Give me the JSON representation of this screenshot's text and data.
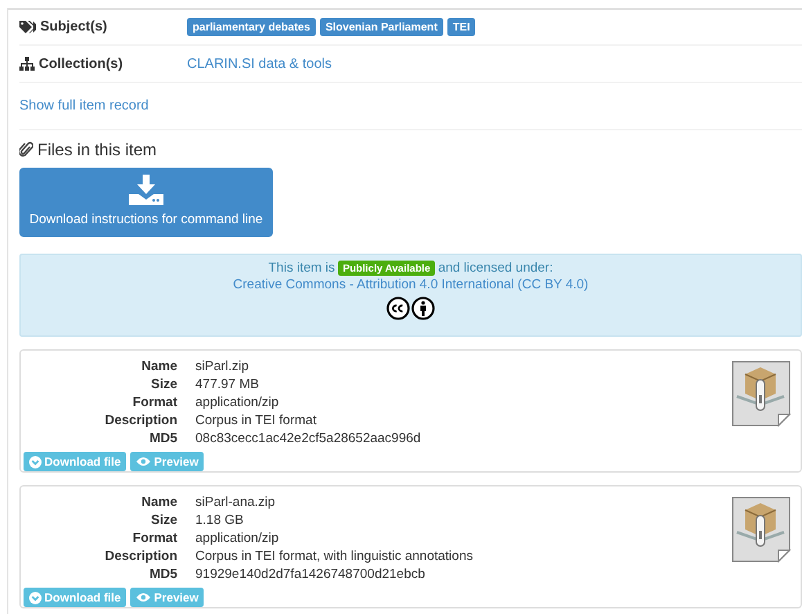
{
  "subjects": {
    "label": "Subject(s)",
    "tags": [
      "parliamentary debates",
      "Slovenian Parliament",
      "TEI"
    ]
  },
  "collections": {
    "label": "Collection(s)",
    "link": "CLARIN.SI data & tools"
  },
  "show_full_record": "Show full item record",
  "files_heading": "Files in this item",
  "download_instructions": "Download instructions for command line",
  "license": {
    "prefix": "This item is",
    "badge": "Publicly Available",
    "suffix": "and licensed under:",
    "link": "Creative Commons - Attribution 4.0 International (CC BY 4.0)"
  },
  "files": [
    {
      "fields": [
        {
          "label": "Name",
          "value": "siParl.zip"
        },
        {
          "label": "Size",
          "value": "477.97 MB"
        },
        {
          "label": "Format",
          "value": "application/zip"
        },
        {
          "label": "Description",
          "value": "Corpus in TEI format"
        },
        {
          "label": "MD5",
          "value": "08c83cecc1ac42e2cf5a28652aac996d"
        }
      ],
      "buttons": [
        {
          "kind": "download",
          "label": "Download file"
        },
        {
          "kind": "preview",
          "label": "Preview"
        }
      ]
    },
    {
      "fields": [
        {
          "label": "Name",
          "value": "siParl-ana.zip"
        },
        {
          "label": "Size",
          "value": "1.18 GB"
        },
        {
          "label": "Format",
          "value": "application/zip"
        },
        {
          "label": "Description",
          "value": "Corpus in TEI format, with linguistic annotations"
        },
        {
          "label": "MD5",
          "value": "91929e140d2d7fa1426748700d21ebcb"
        }
      ],
      "buttons": [
        {
          "kind": "download",
          "label": "Download file"
        },
        {
          "kind": "preview",
          "label": "Preview"
        }
      ]
    }
  ]
}
